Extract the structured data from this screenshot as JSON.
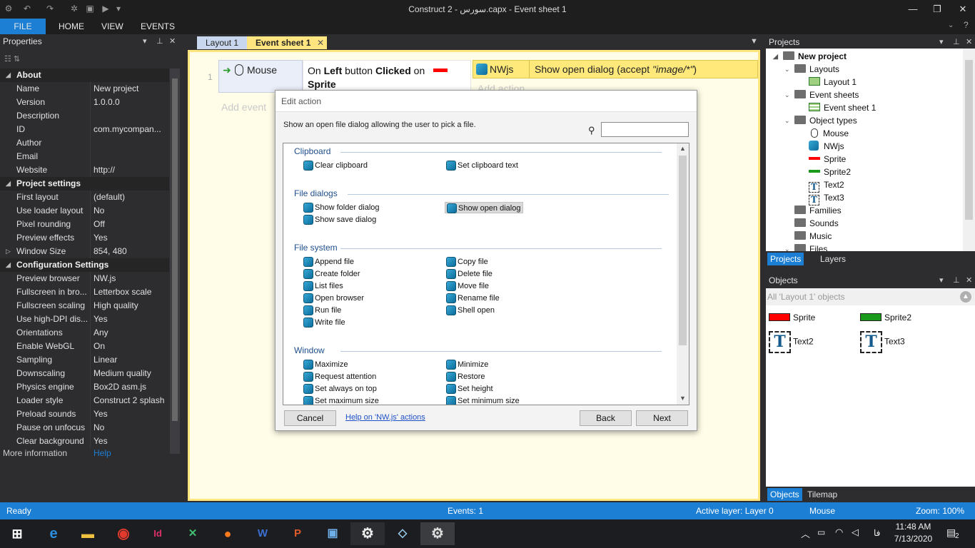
{
  "window": {
    "title": "Construct 2 - سورس.capx - Event sheet 1"
  },
  "ribbon": {
    "tabs": [
      "FILE",
      "HOME",
      "VIEW",
      "EVENTS"
    ]
  },
  "properties": {
    "title": "Properties",
    "rows": [
      {
        "type": "cat",
        "name": "About"
      },
      {
        "name": "Name",
        "value": "New project"
      },
      {
        "name": "Version",
        "value": "1.0.0.0"
      },
      {
        "name": "Description",
        "value": ""
      },
      {
        "name": "ID",
        "value": "com.mycompan..."
      },
      {
        "name": "Author",
        "value": ""
      },
      {
        "name": "Email",
        "value": ""
      },
      {
        "name": "Website",
        "value": "http://"
      },
      {
        "type": "cat",
        "name": "Project settings"
      },
      {
        "name": "First layout",
        "value": "(default)"
      },
      {
        "name": "Use loader layout",
        "value": "No"
      },
      {
        "name": "Pixel rounding",
        "value": "Off"
      },
      {
        "name": "Preview effects",
        "value": "Yes"
      },
      {
        "name": "Window Size",
        "value": "854, 480",
        "expand": true
      },
      {
        "type": "cat",
        "name": "Configuration Settings"
      },
      {
        "name": "Preview browser",
        "value": "NW.js"
      },
      {
        "name": "Fullscreen in bro...",
        "value": "Letterbox scale"
      },
      {
        "name": "Fullscreen scaling",
        "value": "High quality"
      },
      {
        "name": "Use high-DPI dis...",
        "value": "Yes"
      },
      {
        "name": "Orientations",
        "value": "Any"
      },
      {
        "name": "Enable WebGL",
        "value": "On"
      },
      {
        "name": "Sampling",
        "value": "Linear"
      },
      {
        "name": "Downscaling",
        "value": "Medium quality"
      },
      {
        "name": "Physics engine",
        "value": "Box2D asm.js"
      },
      {
        "name": "Loader style",
        "value": "Construct 2 splash"
      },
      {
        "name": "Preload sounds",
        "value": "Yes"
      },
      {
        "name": "Pause on unfocus",
        "value": "No"
      },
      {
        "name": "Clear background",
        "value": "Yes"
      }
    ],
    "more_info": "More information",
    "help_link": "Help"
  },
  "tabs": {
    "layout": "Layout 1",
    "sheet": "Event sheet 1"
  },
  "event": {
    "number": "1",
    "object": "Mouse",
    "cond_pre": "On ",
    "cond_b1": "Left",
    "cond_mid": " button ",
    "cond_b2": "Clicked",
    "cond_on": " on",
    "cond_obj": "Sprite",
    "action_obj": "NWjs",
    "action_text": "Show open dialog (accept ",
    "action_param": "\"image/*\"",
    "action_end": ")",
    "add_action": "Add action",
    "add_event": "Add event"
  },
  "dialog": {
    "title": "Edit action",
    "description": "Show an open file dialog allowing the user to pick a file.",
    "search_value": "",
    "categories": [
      {
        "name": "Clipboard",
        "items": [
          [
            "Clear clipboard",
            "Set clipboard text"
          ]
        ]
      },
      {
        "name": "File dialogs",
        "items": [
          [
            "Show folder dialog",
            "Show open dialog"
          ],
          [
            "Show save dialog",
            ""
          ]
        ]
      },
      {
        "name": "File system",
        "items": [
          [
            "Append file",
            "Copy file"
          ],
          [
            "Create folder",
            "Delete file"
          ],
          [
            "List files",
            "Move file"
          ],
          [
            "Open browser",
            "Rename file"
          ],
          [
            "Run file",
            "Shell open"
          ],
          [
            "Write file",
            ""
          ]
        ]
      },
      {
        "name": "Window",
        "items": [
          [
            "Maximize",
            "Minimize"
          ],
          [
            "Request attention",
            "Restore"
          ],
          [
            "Set always on top",
            "Set height"
          ],
          [
            "Set maximum size",
            "Set minimum size"
          ]
        ]
      }
    ],
    "selected": "Show open dialog",
    "cancel": "Cancel",
    "help": "Help on 'NW.js' actions",
    "back": "Back",
    "next": "Next"
  },
  "projects": {
    "title": "Projects",
    "root": "New project",
    "layouts": "Layouts",
    "layout1": "Layout 1",
    "eventsheets": "Event sheets",
    "eventsheet1": "Event sheet 1",
    "objecttypes": "Object types",
    "objects": [
      "Mouse",
      "NWjs",
      "Sprite",
      "Sprite2",
      "Text2",
      "Text3"
    ],
    "families": "Families",
    "sounds": "Sounds",
    "music": "Music",
    "files": "Files",
    "tab_projects": "Projects",
    "tab_layers": "Layers"
  },
  "objects_panel": {
    "title": "Objects",
    "filter": "All 'Layout 1' objects",
    "items": [
      "Sprite",
      "Sprite2",
      "Text2",
      "Text3"
    ],
    "tab_objects": "Objects",
    "tab_tilemap": "Tilemap"
  },
  "status": {
    "left": "Ready",
    "events": "Events: 1",
    "layer": "Active layer: Layer 0",
    "mouse": "Mouse",
    "zoom": "Zoom: 100%"
  },
  "taskbar": {
    "time": "11:48 AM",
    "date": "7/13/2020",
    "lang": "فا",
    "notif": "2"
  },
  "colors": {
    "accent": "#1c7fd4",
    "sprite": "#ff0000",
    "sprite2": "#1a9a1a"
  }
}
